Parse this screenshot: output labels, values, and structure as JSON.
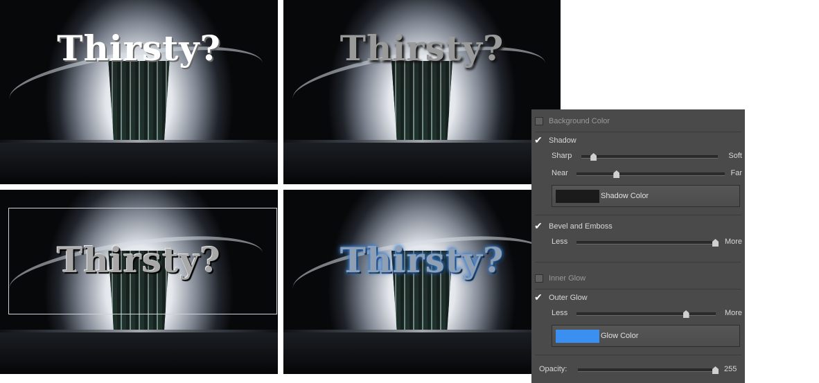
{
  "photos": [
    {
      "title": "Thirsty?"
    },
    {
      "title": "Thirsty?"
    },
    {
      "title": "Thirsty?"
    },
    {
      "title": "Thirsty?"
    }
  ],
  "panel": {
    "background_color": {
      "label": "Background Color",
      "checked": false
    },
    "shadow": {
      "label": "Shadow",
      "checked": true,
      "sharpness": {
        "left": "Sharp",
        "right": "Soft",
        "value": 0.07
      },
      "distance": {
        "left": "Near",
        "right": "Far",
        "value": 0.26
      },
      "color_button": {
        "label": "Shadow Color",
        "color": "#1b1b1b"
      }
    },
    "bevel": {
      "label": "Bevel and Emboss",
      "checked": true,
      "amount": {
        "left": "Less",
        "right": "More",
        "value": 1.0
      }
    },
    "inner_glow": {
      "label": "Inner Glow",
      "checked": false
    },
    "outer_glow": {
      "label": "Outer Glow",
      "checked": true,
      "amount": {
        "left": "Less",
        "right": "More",
        "value": 0.8
      },
      "color_button": {
        "label": "Glow Color",
        "color": "#3b8ff0"
      }
    },
    "opacity": {
      "label": "Opacity:",
      "value": "255",
      "fraction": 1.0
    }
  },
  "icons": {
    "check": "check-icon"
  }
}
